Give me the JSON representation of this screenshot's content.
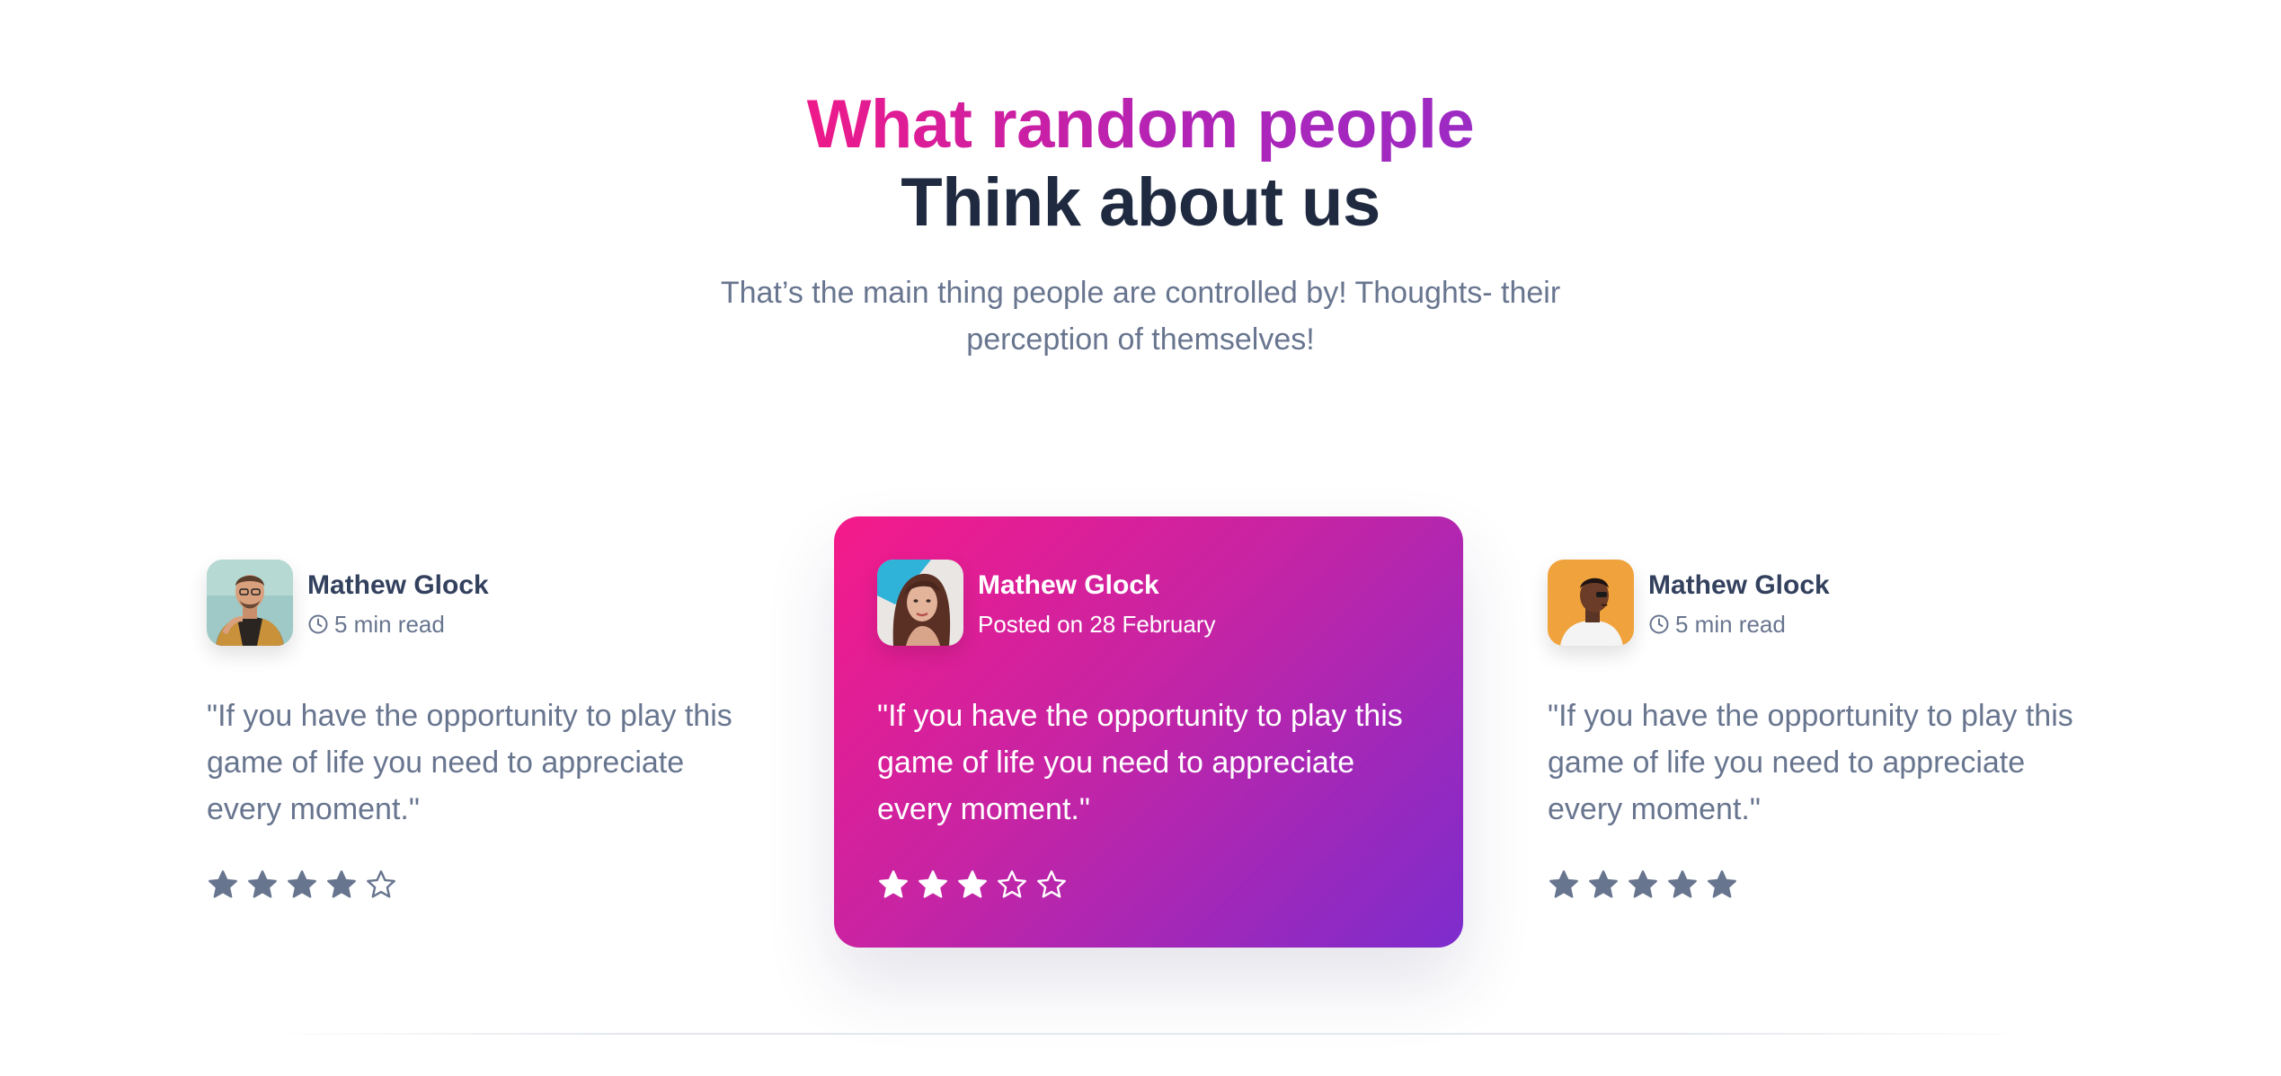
{
  "header": {
    "title_line1": "What random people",
    "title_line2": "Think about us",
    "subtitle": "That’s the main thing people are controlled by! Thoughts- their perception of themselves!"
  },
  "testimonials": [
    {
      "name": "Mathew Glock",
      "meta": "5 min read",
      "meta_icon": "clock-icon",
      "quote": "\"If you have the opportunity to play this game of life you need to appreciate every moment.\"",
      "rating": 4,
      "max_rating": 5,
      "avatar_bg": "#9fc9c6",
      "highlighted": false
    },
    {
      "name": "Mathew Glock",
      "meta": "Posted on 28 February",
      "quote": "\"If you have the opportunity to play this game of life you need to appreciate every moment.\"",
      "rating": 3,
      "max_rating": 5,
      "avatar_bg": "#2fb3d9",
      "highlighted": true
    },
    {
      "name": "Mathew Glock",
      "meta": "5 min read",
      "meta_icon": "clock-icon",
      "quote": "\"If you have the opportunity to play this game of life you need to appreciate every moment.\"",
      "rating": 5,
      "max_rating": 5,
      "avatar_bg": "#f0a23c",
      "highlighted": false
    }
  ],
  "colors": {
    "gradient_start": "#f51a8a",
    "gradient_end": "#7d2ccd",
    "heading_dark": "#1f2a40",
    "text_muted": "#68758f",
    "star_filled": "#68758f",
    "star_featured": "#ffffff"
  }
}
